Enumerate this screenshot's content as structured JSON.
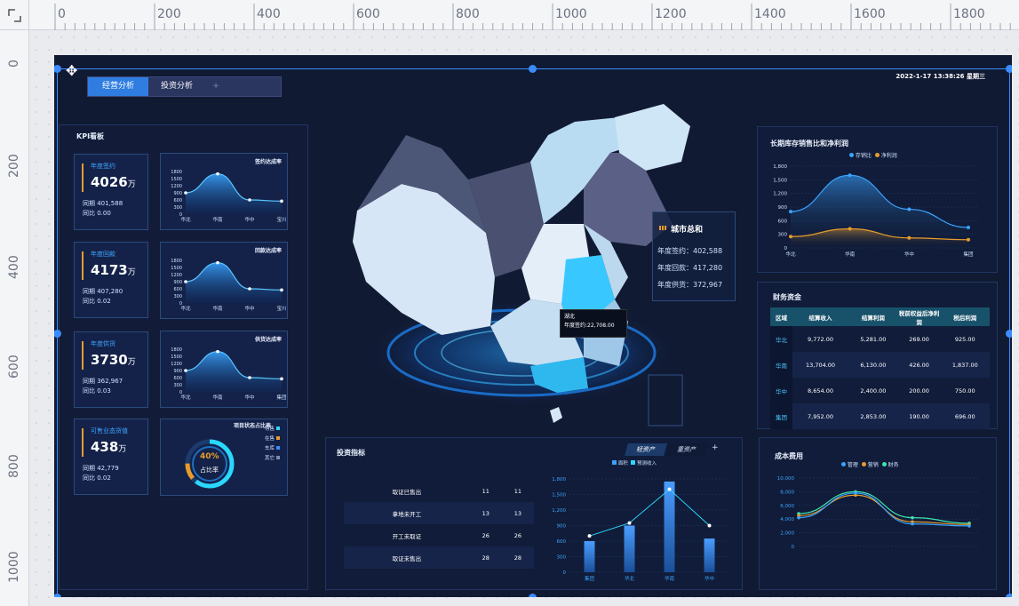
{
  "rulers": {
    "top_ticks": [
      "0",
      "200",
      "400",
      "600",
      "800",
      "1000",
      "1200",
      "1400",
      "1600",
      "1800"
    ],
    "left_ticks": [
      "0",
      "200",
      "400",
      "600",
      "800",
      "1000"
    ]
  },
  "header": {
    "tabs": [
      "经营分析",
      "投资分析"
    ],
    "add_tab": "+",
    "datetime": "2022-1-17 13:38:26  星期三"
  },
  "kpi_board": {
    "title": "KPI看板",
    "cards": [
      {
        "label": "年度签约",
        "value": "4026",
        "unit": "万",
        "row1": "同期  401,588",
        "row2": "同比  0.00"
      },
      {
        "label": "年度回款",
        "value": "4173",
        "unit": "万",
        "row1": "同期 407,280",
        "row2": "同比 0.02"
      },
      {
        "label": "年度供货",
        "value": "3730",
        "unit": "万",
        "row1": "同期 362,967",
        "row2": "同比 0.03"
      },
      {
        "label": "可售业态货值",
        "value": "438",
        "unit": "万",
        "row1": "同期 42,779",
        "row2": "同比 0.02"
      }
    ],
    "minis": [
      {
        "title": "签约达成率",
        "yticks": [
          "1800",
          "1500",
          "1200",
          "900",
          "600",
          "300",
          "0"
        ],
        "xticks": [
          "华北",
          "华南",
          "华中",
          "宝川"
        ],
        "values": [
          900,
          1700,
          600,
          550
        ]
      },
      {
        "title": "回款达成率",
        "yticks": [
          "1800",
          "1500",
          "1200",
          "900",
          "600",
          "300",
          "0"
        ],
        "xticks": [
          "华北",
          "华南",
          "华中",
          "宝川"
        ],
        "values": [
          900,
          1700,
          600,
          550
        ]
      },
      {
        "title": "供货达成率",
        "yticks": [
          "1800",
          "1500",
          "1200",
          "900",
          "600",
          "300",
          "0"
        ],
        "xticks": [
          "华北",
          "华南",
          "华中",
          "集团"
        ],
        "values": [
          900,
          1700,
          600,
          550
        ]
      }
    ],
    "donut": {
      "title": "项目状态占比表",
      "percent": "40%",
      "label": "占比率",
      "legend": [
        "待售",
        "在售",
        "车库",
        "其它"
      ]
    }
  },
  "map": {
    "city_title": "城市总和",
    "rows": [
      "年度签约：402,588",
      "年度回款：417,280",
      "年度供货：372,967"
    ],
    "tooltip_line1": "湖北",
    "tooltip_line2": "年度签约:22,708.00"
  },
  "long_stock": {
    "title": "长期库存销售比和净利润",
    "legend": [
      "存销比",
      "净利润"
    ],
    "yticks": [
      "1,800",
      "1,500",
      "1,200",
      "900",
      "600",
      "300",
      "0"
    ],
    "xticks": [
      "华北",
      "华南",
      "华中",
      "集团"
    ],
    "series1": [
      800,
      1600,
      850,
      450
    ],
    "series2": [
      250,
      420,
      220,
      180
    ]
  },
  "finance": {
    "title": "财务资金",
    "headers": [
      "区域",
      "结算收入",
      "结算利润",
      "税前权益后净利润",
      "税后利润"
    ],
    "rows": [
      [
        "华北",
        "9,772.00",
        "5,281.00",
        "269.00",
        "925.00"
      ],
      [
        "华南",
        "13,704.00",
        "6,130.00",
        "426.00",
        "1,837.00"
      ],
      [
        "华中",
        "8,654.00",
        "2,400.00",
        "200.00",
        "750.00"
      ],
      [
        "集团",
        "7,952.00",
        "2,853.00",
        "190.00",
        "696.00"
      ]
    ]
  },
  "investment": {
    "title": "投资指标",
    "tabs": [
      "轻资产",
      "重资产"
    ],
    "add": "+",
    "legend": [
      "面积",
      "预测收入"
    ],
    "rows": [
      [
        "取证已售出",
        "11",
        "11"
      ],
      [
        "拿地未开工",
        "13",
        "13"
      ],
      [
        "开工未取证",
        "26",
        "26"
      ],
      [
        "取证未售出",
        "28",
        "28"
      ]
    ],
    "yticks": [
      "1,800",
      "1,500",
      "1,200",
      "900",
      "600",
      "300",
      "0"
    ],
    "xticks": [
      "集团",
      "华北",
      "华南",
      "华中"
    ],
    "bars": [
      600,
      900,
      1750,
      650
    ],
    "line": [
      700,
      950,
      1600,
      900
    ]
  },
  "cost": {
    "title": "成本费用",
    "legend": [
      "管理",
      "营销",
      "财务"
    ],
    "yticks": [
      "10,000",
      "8,000",
      "6,000",
      "4,000",
      "2,000",
      "0"
    ],
    "s1": [
      4200,
      7800,
      3300,
      3000
    ],
    "s2": [
      4500,
      7500,
      3600,
      3200
    ],
    "s3": [
      4800,
      8000,
      4200,
      3400
    ]
  }
}
